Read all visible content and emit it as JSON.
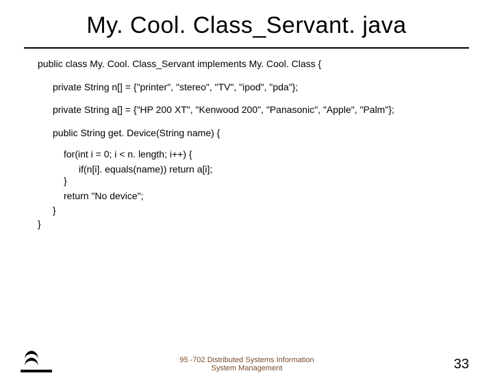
{
  "title": "My. Cool. Class_Servant. java",
  "code": {
    "class_decl": "public class My. Cool. Class_Servant implements My. Cool. Class {",
    "field_n": "private String n[] = {\"printer\", \"stereo\", \"TV\", \"ipod\", \"pda\"};",
    "field_a": "private String a[] = {\"HP 200 XT\", \"Kenwood 200\", \"Panasonic\", \"Apple\", \"Palm\"};",
    "method_decl": "public String get. Device(String name) {",
    "for_line": "for(int i = 0; i < n. length; i++) {",
    "if_line": "if(n[i]. equals(name)) return a[i];",
    "for_close": "}",
    "return_line": "return \"No device\";",
    "method_close": "}",
    "class_close": "}"
  },
  "footer": {
    "text_line1": "95 -702 Distributed Systems Information",
    "text_line2": "System Management",
    "page": "33"
  }
}
